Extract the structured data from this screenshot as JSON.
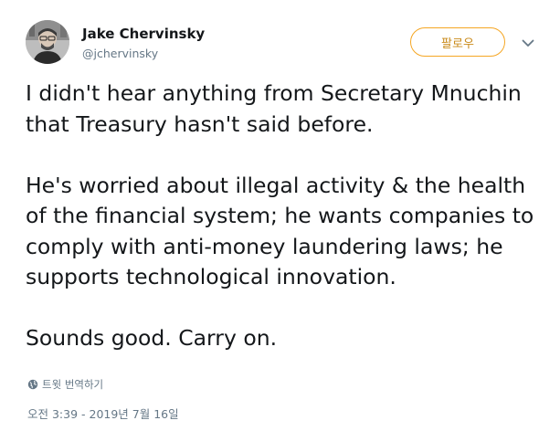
{
  "author": {
    "display_name": "Jake Chervinsky",
    "username": "@jchervinsky",
    "avatar_icon": "avatar-photo"
  },
  "actions": {
    "follow_label": "팔로우",
    "caret_icon": "chevron-down-icon"
  },
  "tweet": {
    "paragraphs": [
      "I didn't hear anything from Secretary Mnuchin that Treasury hasn't said before.",
      "He's worried about illegal activity & the health of the financial system; he wants companies to comply with anti-money laundering laws; he supports technological innovation.",
      "Sounds good. Carry on."
    ]
  },
  "translate": {
    "label": "트윗 번역하기",
    "icon": "globe-icon"
  },
  "timestamp": "오전 3:39 - 2019년 7월 16일",
  "colors": {
    "accent": "#f5a623",
    "secondary_text": "#657786",
    "primary_text": "#14171a"
  }
}
